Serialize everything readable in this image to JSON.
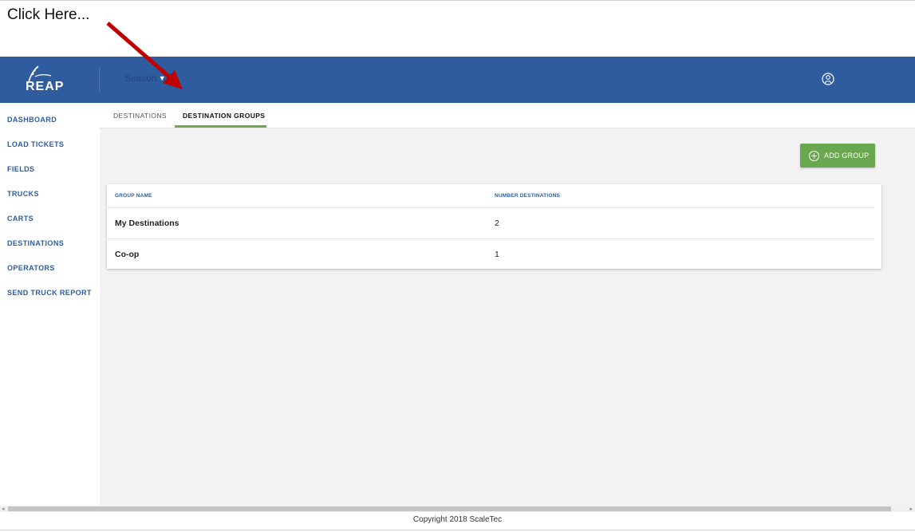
{
  "caption": "Click Here...",
  "header": {
    "logo_text": "REAP",
    "season_label": "Season"
  },
  "sidebar": {
    "items": [
      {
        "label": "DASHBOARD"
      },
      {
        "label": "LOAD TICKETS"
      },
      {
        "label": "FIELDS"
      },
      {
        "label": "TRUCKS"
      },
      {
        "label": "CARTS"
      },
      {
        "label": "DESTINATIONS"
      },
      {
        "label": "OPERATORS"
      },
      {
        "label": "SEND TRUCK REPORT"
      }
    ]
  },
  "tabs": [
    {
      "label": "DESTINATIONS",
      "active": false
    },
    {
      "label": "DESTINATION GROUPS",
      "active": true
    }
  ],
  "actions": {
    "add_group_label": "ADD GROUP"
  },
  "table": {
    "columns": [
      "GROUP NAME",
      "NUMBER DESTINATIONS"
    ],
    "rows": [
      {
        "name": "My Destinations",
        "count": "2"
      },
      {
        "name": "Co-op",
        "count": "1"
      }
    ]
  },
  "footer": {
    "copyright": "Copyright 2018 ScaleTec"
  },
  "colors": {
    "header_bg": "#2e5c9e",
    "accent_green": "#6aa84f",
    "annotation_arrow": "#c00000"
  }
}
